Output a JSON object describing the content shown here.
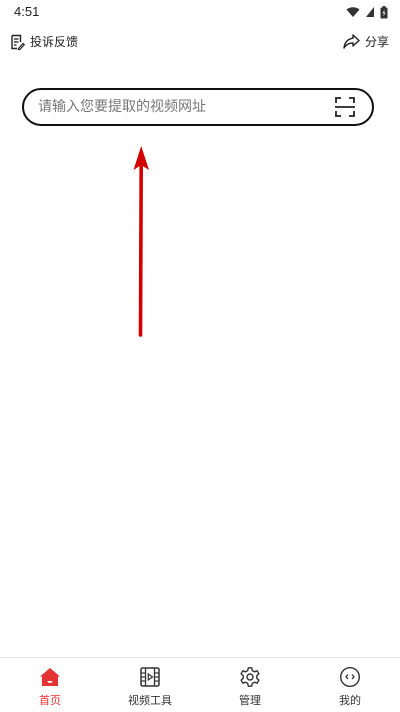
{
  "status_bar": {
    "time": "4:51"
  },
  "header": {
    "complaint_label": "投诉反馈",
    "share_label": "分享"
  },
  "search": {
    "placeholder": "请输入您要提取的视频网址"
  },
  "bottom_nav": {
    "items": [
      {
        "label": "首页",
        "icon": "home-icon",
        "active": true
      },
      {
        "label": "视频工具",
        "icon": "video-tool-icon",
        "active": false
      },
      {
        "label": "管理",
        "icon": "gear-icon",
        "active": false
      },
      {
        "label": "我的",
        "icon": "profile-icon",
        "active": false
      }
    ]
  },
  "colors": {
    "accent": "#e33333",
    "annotation_arrow": "#d40000"
  }
}
